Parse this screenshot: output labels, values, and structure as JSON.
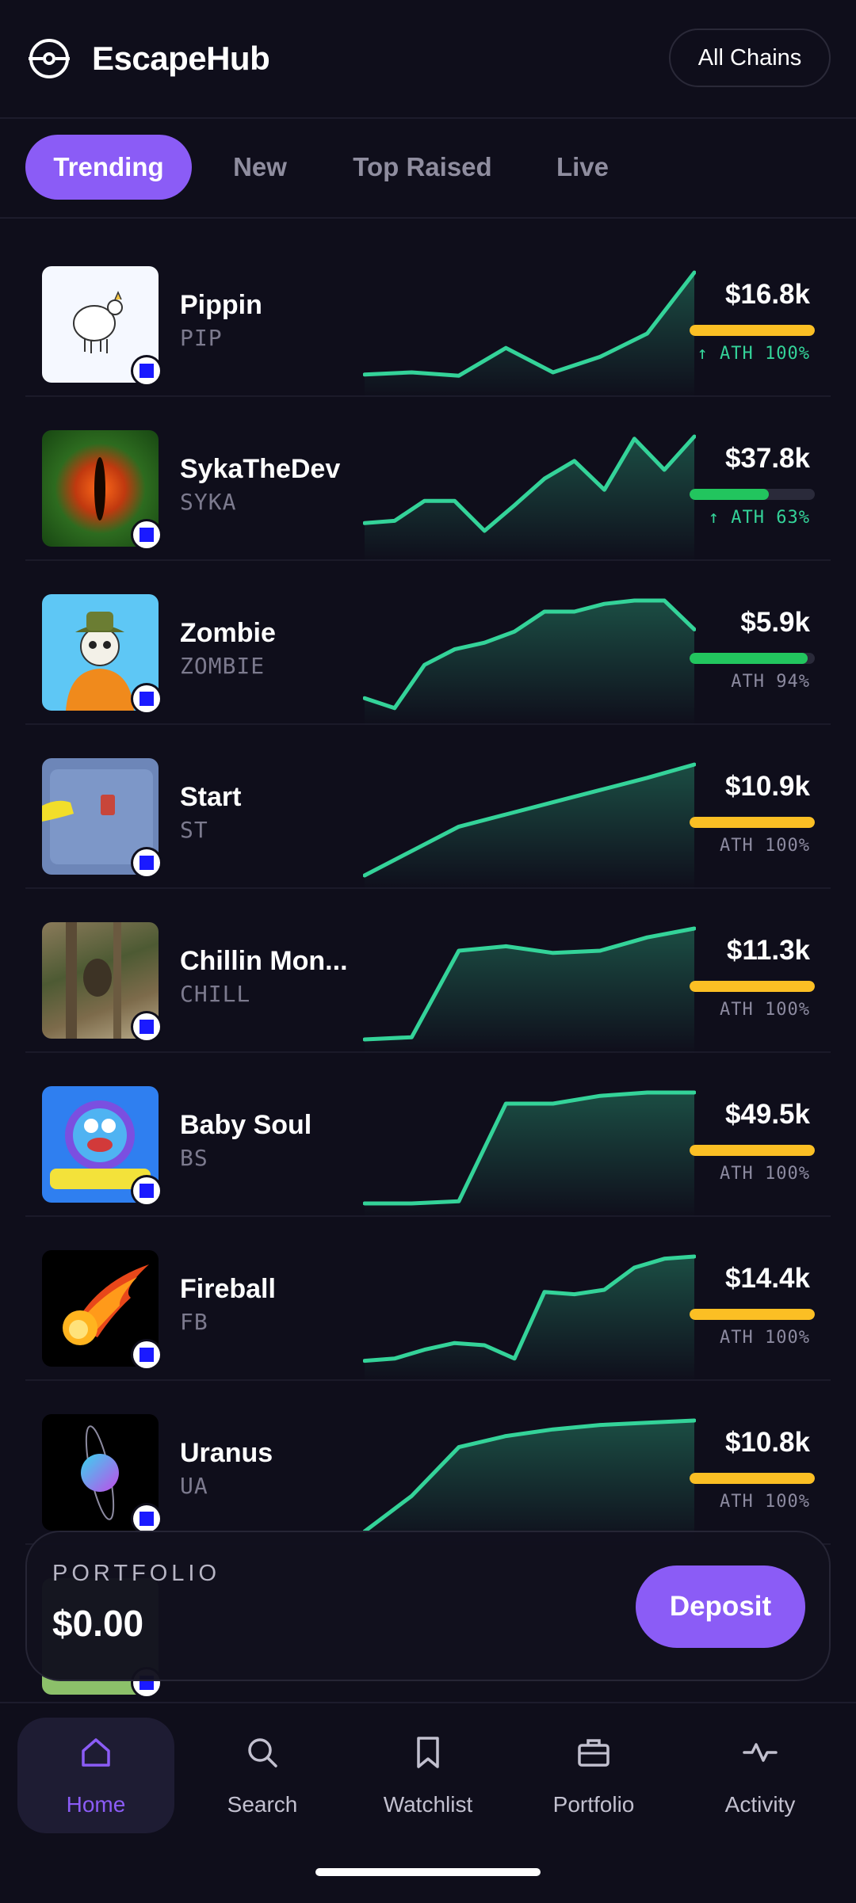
{
  "header": {
    "app_title": "EscapeHub",
    "chains_button": "All Chains"
  },
  "tabs": [
    {
      "label": "Trending",
      "active": true
    },
    {
      "label": "New",
      "active": false
    },
    {
      "label": "Top Raised",
      "active": false
    },
    {
      "label": "Live",
      "active": false
    }
  ],
  "colors": {
    "accent": "#8b5cf6",
    "up": "#34d399",
    "green_bar": "#22c55e",
    "yellow_bar": "#fbbf24",
    "background": "#0f0e1b"
  },
  "tokens": [
    {
      "name": "Pippin",
      "symbol": "PIP",
      "price": "$16.8k",
      "ath": "↑ ATH 100%",
      "ath_pct": 100,
      "bar_color": "yellow",
      "ath_up": true,
      "spark": [
        0.08,
        0.1,
        0.07,
        0.32,
        0.1,
        0.24,
        0.45,
        1.0
      ]
    },
    {
      "name": "SykaTheDev",
      "symbol": "SYKA",
      "price": "$37.8k",
      "ath": "↑ ATH 63%",
      "ath_pct": 63,
      "bar_color": "green",
      "ath_up": true,
      "spark": [
        0.22,
        0.24,
        0.42,
        0.42,
        0.15,
        0.38,
        0.62,
        0.78,
        0.52,
        0.98,
        0.7,
        1.0
      ]
    },
    {
      "name": "Zombie",
      "symbol": "ZOMBIE",
      "price": "$5.9k",
      "ath": "ATH 94%",
      "ath_pct": 94,
      "bar_color": "green",
      "ath_up": false,
      "spark": [
        0.12,
        0.03,
        0.42,
        0.56,
        0.62,
        0.72,
        0.9,
        0.9,
        0.97,
        1.0,
        1.0,
        0.74
      ]
    },
    {
      "name": "Start",
      "symbol": "ST",
      "price": "$10.9k",
      "ath": "ATH 100%",
      "ath_pct": 100,
      "bar_color": "yellow",
      "ath_up": false,
      "spark": [
        0.0,
        0.22,
        0.44,
        0.55,
        0.66,
        0.77,
        0.88,
        1.0
      ]
    },
    {
      "name": "Chillin Mon...",
      "symbol": "CHILL",
      "price": "$11.3k",
      "ath": "ATH 100%",
      "ath_pct": 100,
      "bar_color": "yellow",
      "ath_up": false,
      "spark": [
        0.0,
        0.02,
        0.8,
        0.84,
        0.78,
        0.8,
        0.92,
        1.0
      ]
    },
    {
      "name": "Baby Soul",
      "symbol": "BS",
      "price": "$49.5k",
      "ath": "ATH 100%",
      "ath_pct": 100,
      "bar_color": "yellow",
      "ath_up": false,
      "spark": [
        0.0,
        0.0,
        0.02,
        0.9,
        0.9,
        0.97,
        1.0,
        1.0
      ]
    },
    {
      "name": "Fireball",
      "symbol": "FB",
      "price": "$14.4k",
      "ath": "ATH 100%",
      "ath_pct": 100,
      "bar_color": "yellow",
      "ath_up": false,
      "spark": [
        0.06,
        0.08,
        0.16,
        0.22,
        0.2,
        0.08,
        0.68,
        0.66,
        0.7,
        0.9,
        0.98,
        1.0
      ]
    },
    {
      "name": "Uranus",
      "symbol": "UA",
      "price": "$10.8k",
      "ath": "ATH 100%",
      "ath_pct": 100,
      "bar_color": "yellow",
      "ath_up": false,
      "spark": [
        0.0,
        0.32,
        0.76,
        0.86,
        0.92,
        0.96,
        0.98,
        1.0
      ]
    }
  ],
  "portfolio": {
    "label": "PORTFOLIO",
    "value": "$0.00",
    "deposit_button": "Deposit"
  },
  "bottom_nav": [
    {
      "label": "Home",
      "icon": "home-icon",
      "active": true
    },
    {
      "label": "Search",
      "icon": "search-icon",
      "active": false
    },
    {
      "label": "Watchlist",
      "icon": "bookmark-icon",
      "active": false
    },
    {
      "label": "Portfolio",
      "icon": "briefcase-icon",
      "active": false
    },
    {
      "label": "Activity",
      "icon": "activity-icon",
      "active": false
    }
  ]
}
